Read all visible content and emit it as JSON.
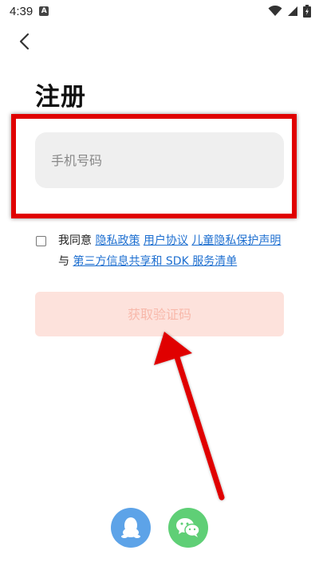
{
  "status_bar": {
    "time": "4:39",
    "notification_badge": "A"
  },
  "page": {
    "title": "注册"
  },
  "form": {
    "phone_placeholder": "手机号码"
  },
  "agreement": {
    "prefix": "我同意 ",
    "privacy_policy": "隐私政策",
    "user_agreement": "用户协议",
    "child_privacy": "儿童隐私保护声明",
    "and": " 与 ",
    "third_party": "第三方信息共享和 SDK 服务清单"
  },
  "button": {
    "get_code": "获取验证码"
  },
  "social_logins": [
    "qq",
    "wechat"
  ],
  "colors": {
    "accent_button_bg": "#fde2dc",
    "accent_button_text": "#f8b8aa",
    "link": "#1e6fd0",
    "annotation_red": "#e00000",
    "qq_blue": "#5da3e8",
    "wechat_green": "#5fcf76"
  }
}
